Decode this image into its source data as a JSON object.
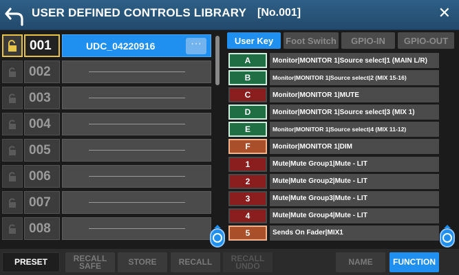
{
  "header": {
    "title": "USER DEFINED CONTROLS LIBRARY",
    "number": "[No.001]",
    "close_label": "✕"
  },
  "presets": [
    {
      "num": "001",
      "name": "UDC_04220916",
      "selected": true,
      "more_label": "···"
    },
    {
      "num": "002",
      "name": ""
    },
    {
      "num": "003",
      "name": ""
    },
    {
      "num": "004",
      "name": ""
    },
    {
      "num": "005",
      "name": ""
    },
    {
      "num": "006",
      "name": ""
    },
    {
      "num": "007",
      "name": ""
    },
    {
      "num": "008",
      "name": ""
    }
  ],
  "tabs": [
    {
      "label": "User Key",
      "active": true
    },
    {
      "label": "Foot Switch"
    },
    {
      "label": "GPIO-IN"
    },
    {
      "label": "GPIO-OUT"
    }
  ],
  "keys": [
    {
      "key": "A",
      "color": "green",
      "desc": "Monitor|MONITOR 1|Source select|1 (MAIN L/R)"
    },
    {
      "key": "B",
      "color": "green",
      "desc": "Monitor|MONITOR 1|Source select|2 (MIX 15-16)",
      "small": true
    },
    {
      "key": "C",
      "color": "red",
      "desc": "Monitor|MONITOR 1|MUTE"
    },
    {
      "key": "D",
      "color": "green",
      "desc": "Monitor|MONITOR 1|Source select|3 (MIX 1)"
    },
    {
      "key": "E",
      "color": "green",
      "desc": "Monitor|MONITOR 1|Source select|4 (MIX 11-12)",
      "small": true
    },
    {
      "key": "F",
      "color": "orange",
      "desc": "Monitor|MONITOR 1|DIM"
    },
    {
      "key": "1",
      "color": "red",
      "desc": "Mute|Mute Group1|Mute - LIT"
    },
    {
      "key": "2",
      "color": "red",
      "desc": "Mute|Mute Group2|Mute - LIT"
    },
    {
      "key": "3",
      "color": "red",
      "desc": "Mute|Mute Group3|Mute - LIT"
    },
    {
      "key": "4",
      "color": "red",
      "desc": "Mute|Mute Group4|Mute - LIT"
    },
    {
      "key": "5",
      "color": "orange",
      "desc": "Sends On Fader|MIX1"
    }
  ],
  "bottom": {
    "preset": "PRESET",
    "recall_safe_line1": "RECALL",
    "recall_safe_line2": "SAFE",
    "store": "STORE",
    "recall": "RECALL",
    "recall_undo_line1": "RECALL",
    "recall_undo_line2": "UNDO",
    "name": "NAME",
    "function": "FUNCTION"
  },
  "colors": {
    "accent": "#1f8ff0",
    "selection_border": "#e6c44a",
    "key_green": "#1f6e44",
    "key_red": "#8a1e1e",
    "key_orange": "#a9502a"
  }
}
